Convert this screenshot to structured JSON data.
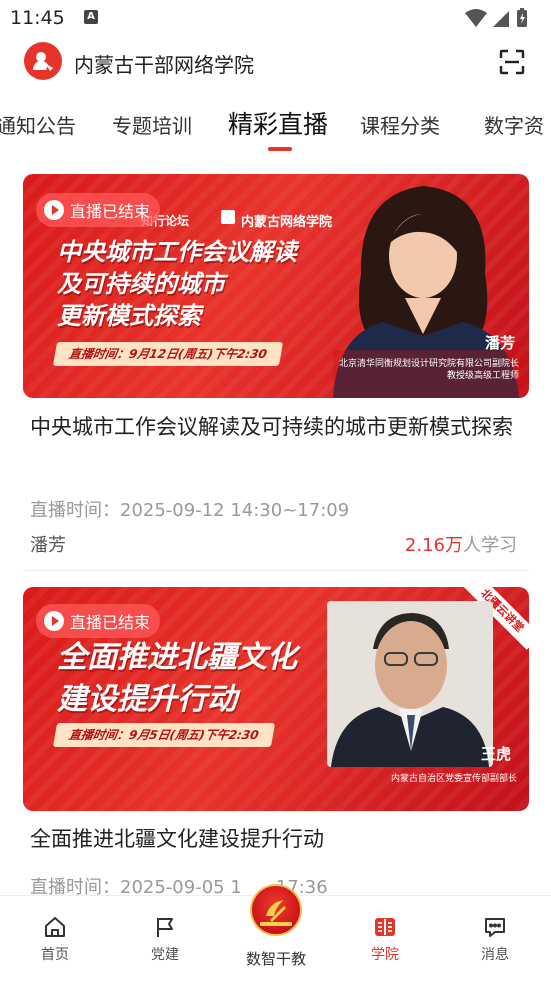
{
  "status_bar": {
    "time": "11:45",
    "notification_icon": "A"
  },
  "header": {
    "title": "内蒙古干部网络学院",
    "logo_icon": "college-logo-icon",
    "scan_icon": "scan-icon"
  },
  "tabs": [
    {
      "label": "通知公告"
    },
    {
      "label": "专题培训"
    },
    {
      "label": "精彩直播",
      "active": true
    },
    {
      "label": "课程分类"
    },
    {
      "label": "数字资"
    }
  ],
  "cards": [
    {
      "badge": "直播已结束",
      "banner_forum": "知行论坛",
      "banner_org": "内蒙古网络学院",
      "banner_title_lines": [
        "中央城市工作会议解读",
        "及可持续的城市",
        "更新模式探索"
      ],
      "banner_time": "直播时间：9月12日(周五)下午2:30",
      "speaker_name": "潘芳",
      "speaker_role_lines": [
        "北京清华同衡规划设计研究院有限公司副院长",
        "教授级高级工程师"
      ],
      "title": "中央城市工作会议解读及可持续的城市更新模式探索",
      "time": "直播时间：2025-09-12 14:30~17:09",
      "speaker": "潘芳",
      "learn_count": "2.16万",
      "learn_suffix": "人学习"
    },
    {
      "badge": "直播已结束",
      "corner_tag": "北疆云讲堂",
      "banner_title_lines": [
        "全面推进北疆文化",
        "建设提升行动"
      ],
      "banner_time": "直播时间：9月5日(周五)下午2:30",
      "speaker_name": "王虎",
      "speaker_role_lines": [
        "内蒙古自治区党委宣传部副部长"
      ],
      "title": "全面推进北疆文化建设提升行动",
      "time": "直播时间：2025-09-05 1",
      "time_tail": "17:36"
    }
  ],
  "bottom_nav": [
    {
      "label": "首页",
      "icon": "home-icon"
    },
    {
      "label": "党建",
      "icon": "flag-icon"
    },
    {
      "label": "数智干教",
      "icon": "party-emblem-icon"
    },
    {
      "label": "学院",
      "icon": "college-icon",
      "active": true
    },
    {
      "label": "消息",
      "icon": "message-icon"
    }
  ],
  "colors": {
    "accent": "#e8332b",
    "banner_red": "#d91a1a",
    "muted_text": "#999999"
  }
}
